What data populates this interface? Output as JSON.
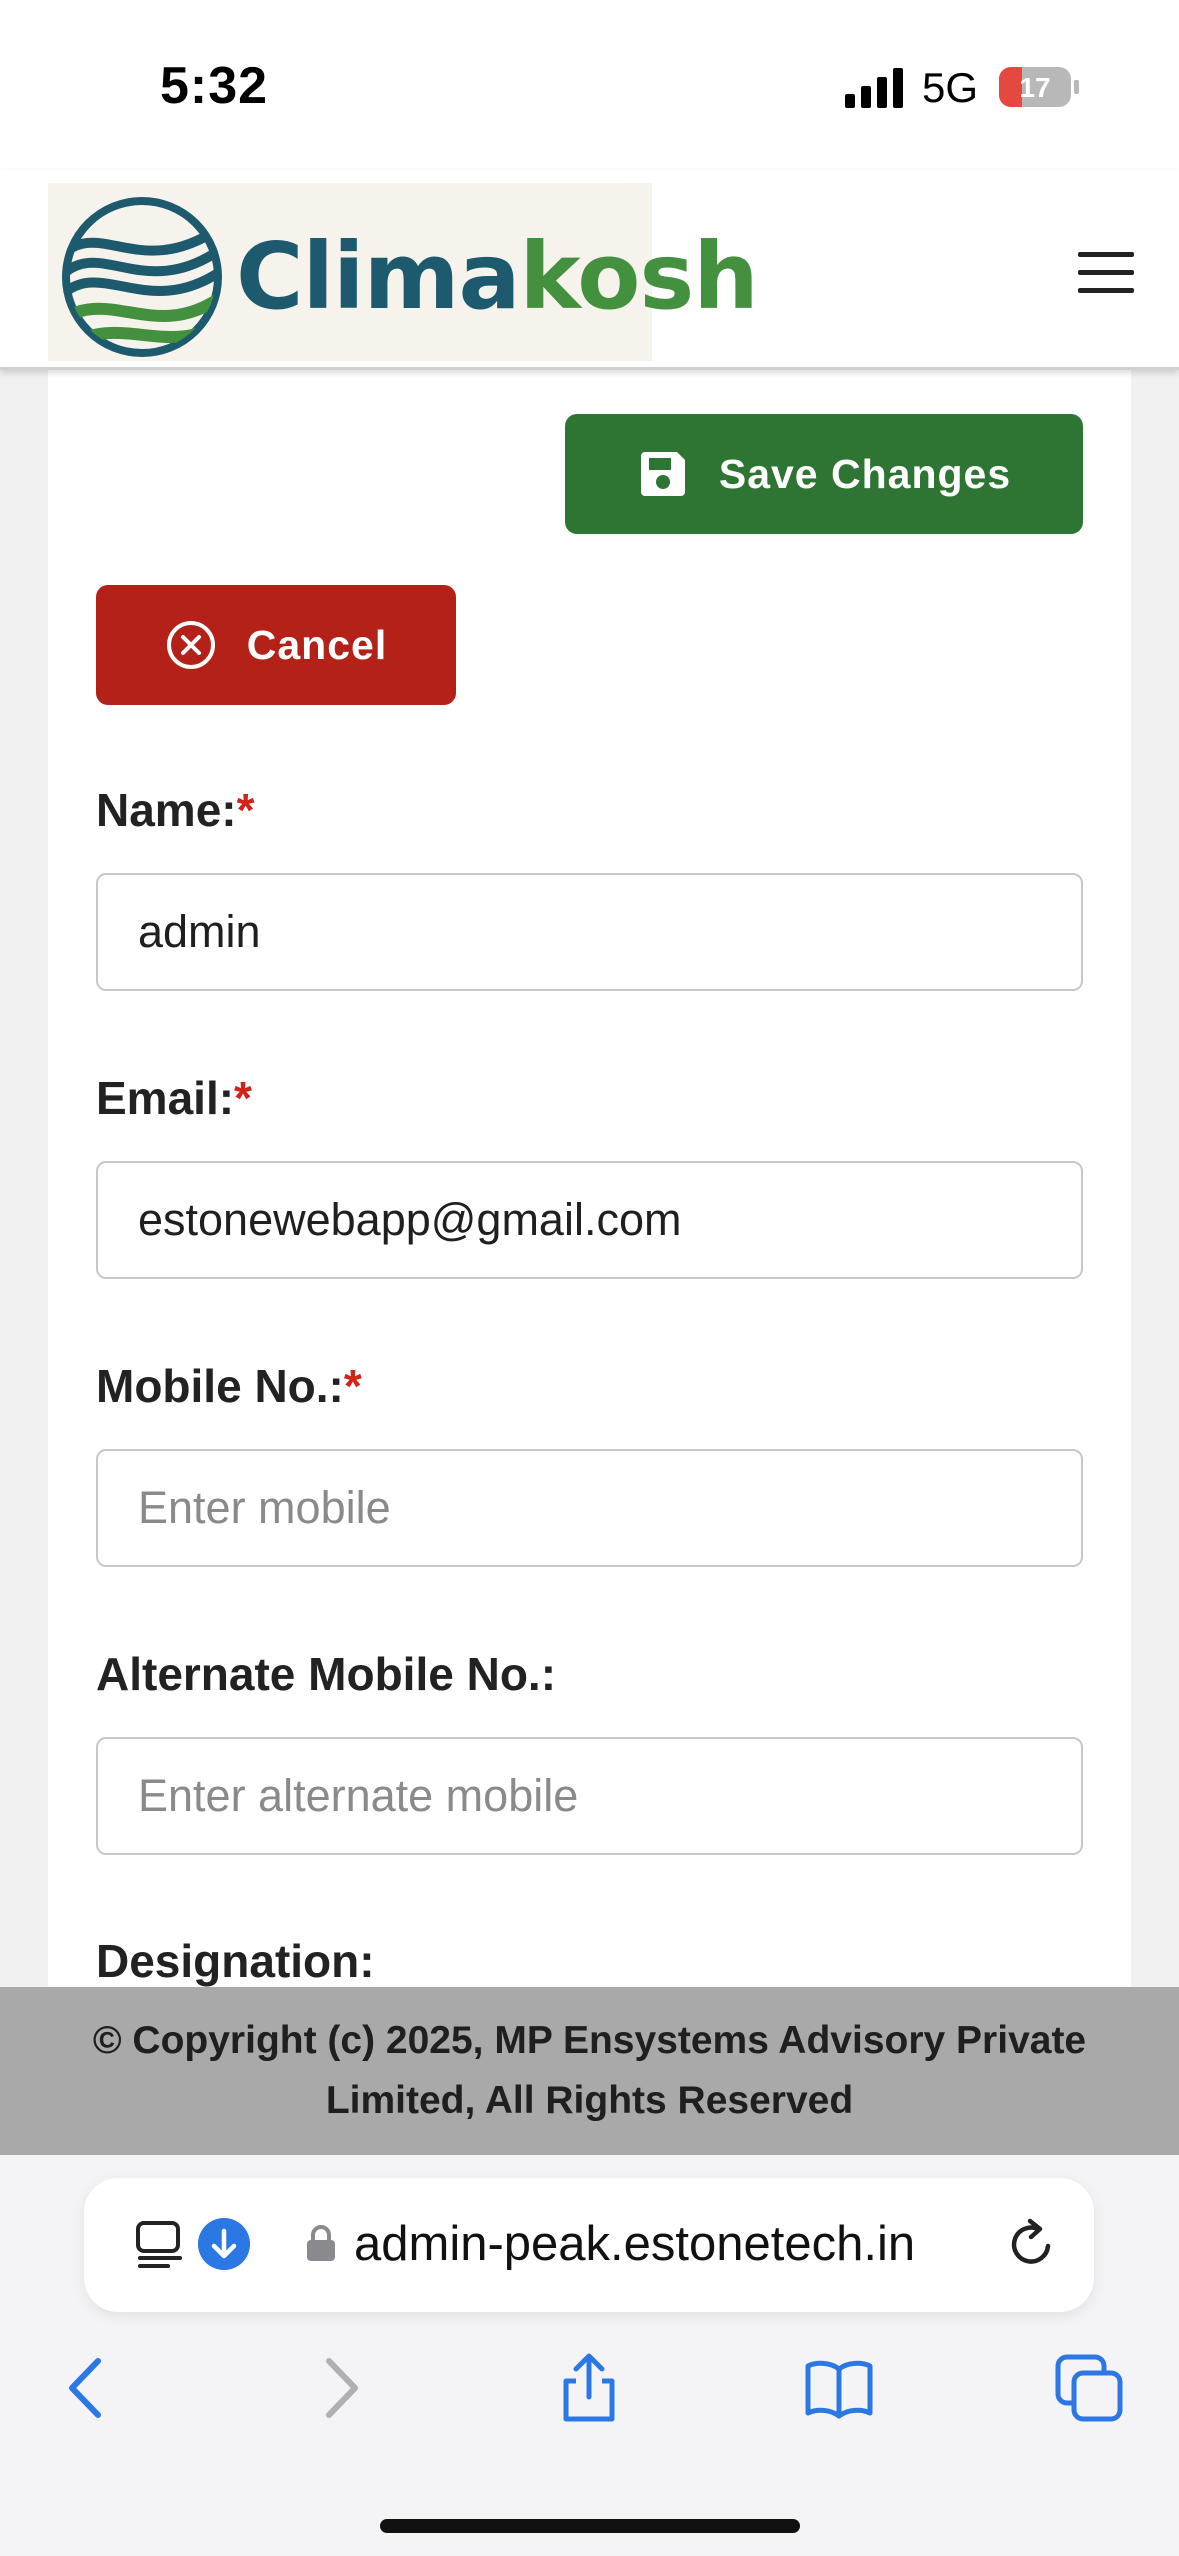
{
  "status_bar": {
    "time": "5:32",
    "network": "5G",
    "battery": "17"
  },
  "header": {
    "logo_part1": "Clima",
    "logo_part2": "kosh",
    "menu_icon": "hamburger-menu-icon"
  },
  "form": {
    "save_label": "Save Changes",
    "cancel_label": "Cancel",
    "required_marker": "*",
    "fields": [
      {
        "label": "Name:",
        "required": true,
        "value": "admin",
        "placeholder": ""
      },
      {
        "label": "Email:",
        "required": true,
        "value": "estonewebapp@gmail.com",
        "placeholder": ""
      },
      {
        "label": "Mobile No.:",
        "required": true,
        "value": "",
        "placeholder": "Enter mobile"
      },
      {
        "label": "Alternate Mobile No.:",
        "required": false,
        "value": "",
        "placeholder": "Enter alternate mobile"
      },
      {
        "label": "Designation:",
        "required": false
      }
    ]
  },
  "footer": {
    "copyright": "© Copyright (c) 2025, MP Ensystems Advisory Private Limited, All Rights Reserved"
  },
  "browser": {
    "url": "admin-peak.estonetech.in",
    "icons": [
      "page-menu-icon",
      "download-icon",
      "lock-icon",
      "reload-icon",
      "back-icon",
      "forward-icon",
      "share-icon",
      "bookmarks-icon",
      "tabs-icon"
    ]
  },
  "colors": {
    "save_button": "#2e7433",
    "cancel_button": "#b32118",
    "required_marker": "#d0231a",
    "logo_blue": "#1e5a6e",
    "logo_green": "#43913f",
    "footer_bg": "#a9a9a9",
    "safari_accent": "#2b78e4"
  }
}
